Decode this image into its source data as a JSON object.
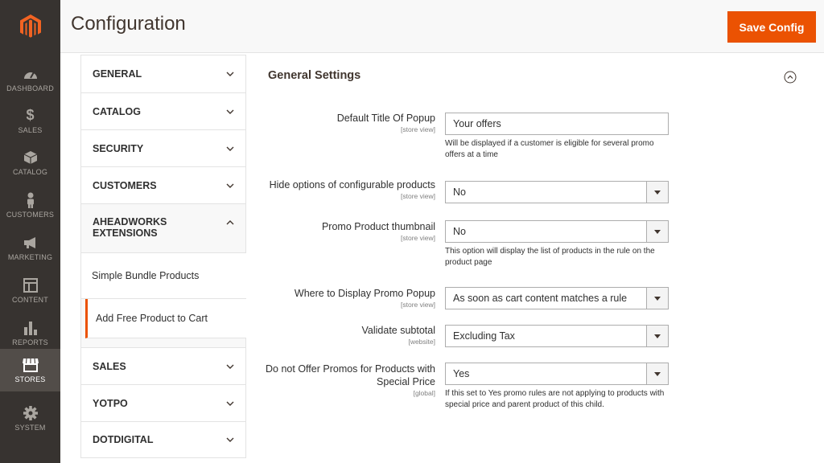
{
  "menu": {
    "items": [
      {
        "label": "DASHBOARD",
        "icon": "dashboard-icon"
      },
      {
        "label": "SALES",
        "icon": "dollar-icon"
      },
      {
        "label": "CATALOG",
        "icon": "box-icon"
      },
      {
        "label": "CUSTOMERS",
        "icon": "person-icon"
      },
      {
        "label": "MARKETING",
        "icon": "megaphone-icon"
      },
      {
        "label": "CONTENT",
        "icon": "layout-icon"
      },
      {
        "label": "REPORTS",
        "icon": "bar-chart-icon"
      },
      {
        "label": "STORES",
        "icon": "store-icon"
      },
      {
        "label": "SYSTEM",
        "icon": "gear-icon"
      }
    ],
    "active": "STORES",
    "colors": {
      "background": "#373330",
      "active": "#524d49",
      "logo": "#f26322"
    }
  },
  "header": {
    "title": "Configuration",
    "save_label": "Save Config",
    "accent": "#eb5202"
  },
  "tabs": {
    "general": "GENERAL",
    "catalog": "CATALOG",
    "security": "SECURITY",
    "customers": "CUSTOMERS",
    "aheadworks": "AHEADWORKS EXTENSIONS",
    "sub": [
      "Simple Bundle Products",
      "Add Free Product to Cart"
    ],
    "sales": "SALES",
    "yotpo": "YOTPO",
    "dotdigital": "DOTDIGITAL"
  },
  "section": {
    "title": "General Settings",
    "rows": [
      {
        "label": "Default Title Of Popup",
        "scope": "[store view]",
        "value": "Your offers",
        "type": "text",
        "note": "Will be displayed if a customer is eligible for several promo offers at a time"
      },
      {
        "label": "Hide options of configurable products",
        "scope": "[store view]",
        "value": "No",
        "type": "select",
        "note": ""
      },
      {
        "label": "Promo Product thumbnail",
        "scope": "[store view]",
        "value": "No",
        "type": "select",
        "note": "This option will display the list of products in the rule on the product page"
      },
      {
        "label": "Where to Display Promo Popup",
        "scope": "[store view]",
        "value": "As soon as cart content matches a rule",
        "type": "select",
        "note": ""
      },
      {
        "label": "Validate subtotal",
        "scope": "[website]",
        "value": "Excluding Tax",
        "type": "select",
        "note": ""
      },
      {
        "label": "Do not Offer Promos for Products with Special Price",
        "scope": "[global]",
        "value": "Yes",
        "type": "select",
        "note": "If this set to Yes promo rules are not applying to products with special price and parent product of this child."
      }
    ]
  }
}
